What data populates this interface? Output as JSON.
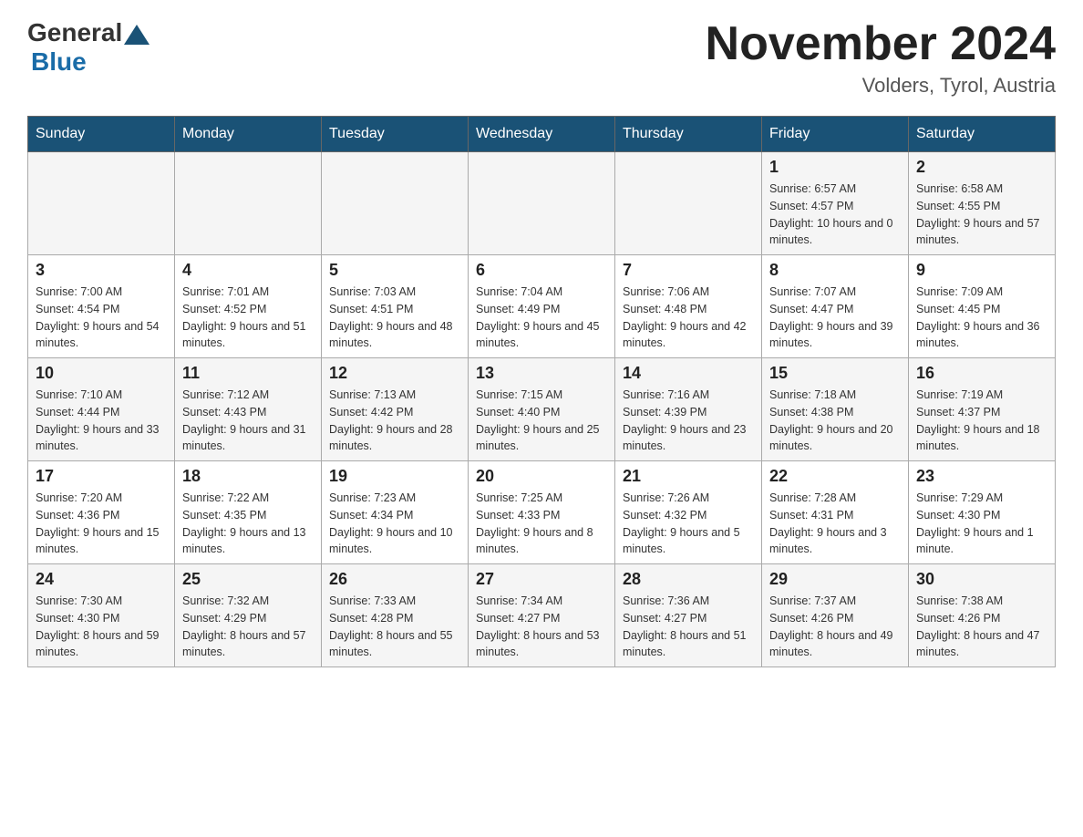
{
  "header": {
    "logo": {
      "general": "General",
      "triangle_color": "#1a5276",
      "blue": "Blue"
    },
    "title": "November 2024",
    "subtitle": "Volders, Tyrol, Austria"
  },
  "calendar": {
    "days_of_week": [
      "Sunday",
      "Monday",
      "Tuesday",
      "Wednesday",
      "Thursday",
      "Friday",
      "Saturday"
    ],
    "weeks": [
      [
        {
          "day": "",
          "info": ""
        },
        {
          "day": "",
          "info": ""
        },
        {
          "day": "",
          "info": ""
        },
        {
          "day": "",
          "info": ""
        },
        {
          "day": "",
          "info": ""
        },
        {
          "day": "1",
          "info": "Sunrise: 6:57 AM\nSunset: 4:57 PM\nDaylight: 10 hours and 0 minutes."
        },
        {
          "day": "2",
          "info": "Sunrise: 6:58 AM\nSunset: 4:55 PM\nDaylight: 9 hours and 57 minutes."
        }
      ],
      [
        {
          "day": "3",
          "info": "Sunrise: 7:00 AM\nSunset: 4:54 PM\nDaylight: 9 hours and 54 minutes."
        },
        {
          "day": "4",
          "info": "Sunrise: 7:01 AM\nSunset: 4:52 PM\nDaylight: 9 hours and 51 minutes."
        },
        {
          "day": "5",
          "info": "Sunrise: 7:03 AM\nSunset: 4:51 PM\nDaylight: 9 hours and 48 minutes."
        },
        {
          "day": "6",
          "info": "Sunrise: 7:04 AM\nSunset: 4:49 PM\nDaylight: 9 hours and 45 minutes."
        },
        {
          "day": "7",
          "info": "Sunrise: 7:06 AM\nSunset: 4:48 PM\nDaylight: 9 hours and 42 minutes."
        },
        {
          "day": "8",
          "info": "Sunrise: 7:07 AM\nSunset: 4:47 PM\nDaylight: 9 hours and 39 minutes."
        },
        {
          "day": "9",
          "info": "Sunrise: 7:09 AM\nSunset: 4:45 PM\nDaylight: 9 hours and 36 minutes."
        }
      ],
      [
        {
          "day": "10",
          "info": "Sunrise: 7:10 AM\nSunset: 4:44 PM\nDaylight: 9 hours and 33 minutes."
        },
        {
          "day": "11",
          "info": "Sunrise: 7:12 AM\nSunset: 4:43 PM\nDaylight: 9 hours and 31 minutes."
        },
        {
          "day": "12",
          "info": "Sunrise: 7:13 AM\nSunset: 4:42 PM\nDaylight: 9 hours and 28 minutes."
        },
        {
          "day": "13",
          "info": "Sunrise: 7:15 AM\nSunset: 4:40 PM\nDaylight: 9 hours and 25 minutes."
        },
        {
          "day": "14",
          "info": "Sunrise: 7:16 AM\nSunset: 4:39 PM\nDaylight: 9 hours and 23 minutes."
        },
        {
          "day": "15",
          "info": "Sunrise: 7:18 AM\nSunset: 4:38 PM\nDaylight: 9 hours and 20 minutes."
        },
        {
          "day": "16",
          "info": "Sunrise: 7:19 AM\nSunset: 4:37 PM\nDaylight: 9 hours and 18 minutes."
        }
      ],
      [
        {
          "day": "17",
          "info": "Sunrise: 7:20 AM\nSunset: 4:36 PM\nDaylight: 9 hours and 15 minutes."
        },
        {
          "day": "18",
          "info": "Sunrise: 7:22 AM\nSunset: 4:35 PM\nDaylight: 9 hours and 13 minutes."
        },
        {
          "day": "19",
          "info": "Sunrise: 7:23 AM\nSunset: 4:34 PM\nDaylight: 9 hours and 10 minutes."
        },
        {
          "day": "20",
          "info": "Sunrise: 7:25 AM\nSunset: 4:33 PM\nDaylight: 9 hours and 8 minutes."
        },
        {
          "day": "21",
          "info": "Sunrise: 7:26 AM\nSunset: 4:32 PM\nDaylight: 9 hours and 5 minutes."
        },
        {
          "day": "22",
          "info": "Sunrise: 7:28 AM\nSunset: 4:31 PM\nDaylight: 9 hours and 3 minutes."
        },
        {
          "day": "23",
          "info": "Sunrise: 7:29 AM\nSunset: 4:30 PM\nDaylight: 9 hours and 1 minute."
        }
      ],
      [
        {
          "day": "24",
          "info": "Sunrise: 7:30 AM\nSunset: 4:30 PM\nDaylight: 8 hours and 59 minutes."
        },
        {
          "day": "25",
          "info": "Sunrise: 7:32 AM\nSunset: 4:29 PM\nDaylight: 8 hours and 57 minutes."
        },
        {
          "day": "26",
          "info": "Sunrise: 7:33 AM\nSunset: 4:28 PM\nDaylight: 8 hours and 55 minutes."
        },
        {
          "day": "27",
          "info": "Sunrise: 7:34 AM\nSunset: 4:27 PM\nDaylight: 8 hours and 53 minutes."
        },
        {
          "day": "28",
          "info": "Sunrise: 7:36 AM\nSunset: 4:27 PM\nDaylight: 8 hours and 51 minutes."
        },
        {
          "day": "29",
          "info": "Sunrise: 7:37 AM\nSunset: 4:26 PM\nDaylight: 8 hours and 49 minutes."
        },
        {
          "day": "30",
          "info": "Sunrise: 7:38 AM\nSunset: 4:26 PM\nDaylight: 8 hours and 47 minutes."
        }
      ]
    ]
  }
}
